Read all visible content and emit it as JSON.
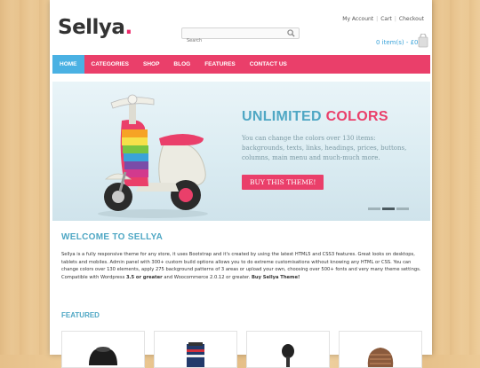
{
  "brand": {
    "logo": "Sellya",
    "logo_dot": ".",
    "tagline": ""
  },
  "toplinks": [
    "My Account",
    "Cart",
    "Checkout"
  ],
  "search": {
    "placeholder": "Search"
  },
  "cart": {
    "total": "0 item(s) - £0"
  },
  "nav": {
    "items": [
      "HOME",
      "CATEGORIES",
      "SHOP",
      "BLOG",
      "FEATURES",
      "CONTACT US"
    ],
    "active_index": 0
  },
  "slider": {
    "title_part1": "UNLIMITED",
    "title_part2": "COLORS",
    "text": "You can change the colors over 130 items: backgrounds, texts, links, headings, prices, buttons, columns, main menu and much-much more.",
    "button": "BUY THIS THEME!",
    "slides": 3,
    "current_slide": 2
  },
  "welcome": {
    "title": "WELCOME TO SELLYA",
    "paragraph1": "Sellya is a fully responsive theme for any store, it uses Bootstrap and it's created by using the latest HTML5 and CSS3 features. Great looks on desktops, tablets and mobiles. Admin panel with 300+ custom build options allows you to do extreme customisations without knowing any HTML or CSS. You can change colors over 130 elements, apply 275 background patterns of 3 areas or upload your own, choosing over 500+ fonts and very many theme settings.",
    "paragraph2_pre": "Compatible with Wordpress",
    "paragraph2_v1": "3.5 or greater",
    "paragraph2_mid": "and Woocommerce 2.0.12 or greater.",
    "paragraph2_link": "Buy Sellya Theme!"
  },
  "featured": {
    "title": "FEATURED",
    "products": [
      "product-1",
      "product-2",
      "product-3",
      "product-4"
    ]
  },
  "colors": {
    "accent_pink": "#ea3f6a",
    "accent_blue": "#4ab1e3",
    "heading_blue": "#4fa7c4"
  }
}
